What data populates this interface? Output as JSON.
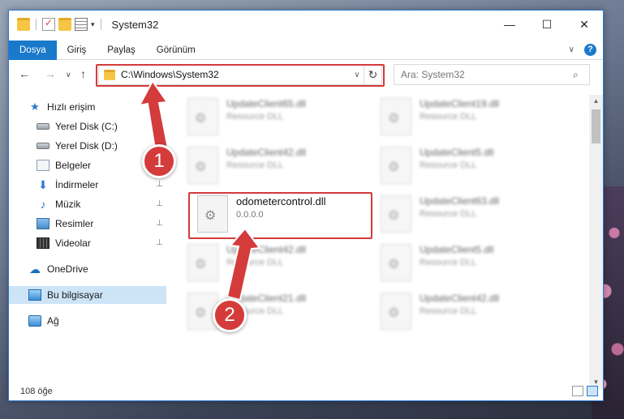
{
  "window": {
    "title": "System32",
    "controls": {
      "minimize": "—",
      "maximize": "☐",
      "close": "✕"
    }
  },
  "ribbon": {
    "tabs": [
      "Dosya",
      "Giriş",
      "Paylaş",
      "Görünüm"
    ],
    "help": "?",
    "expand": "∨"
  },
  "address": {
    "path": "C:\\Windows\\System32",
    "dropdown": "∨",
    "refresh": "↻"
  },
  "nav_buttons": {
    "back": "←",
    "forward": "→",
    "recent": "∨",
    "up": "↑"
  },
  "search": {
    "placeholder": "Ara: System32",
    "icon": "⌕"
  },
  "nav_pane": {
    "items": [
      {
        "label": "Hızlı erişim",
        "icon": "star-icon"
      },
      {
        "label": "Yerel Disk (C:)",
        "icon": "disk-icon",
        "pinned": true
      },
      {
        "label": "Yerel Disk (D:)",
        "icon": "disk-icon",
        "pinned": true
      },
      {
        "label": "Belgeler",
        "icon": "documents-icon",
        "pinned": true
      },
      {
        "label": "İndirmeler",
        "icon": "download-icon",
        "pinned": true
      },
      {
        "label": "Müzik",
        "icon": "music-icon",
        "pinned": true
      },
      {
        "label": "Resimler",
        "icon": "pictures-icon",
        "pinned": true
      },
      {
        "label": "Videolar",
        "icon": "video-icon",
        "pinned": true
      },
      {
        "label": "OneDrive",
        "icon": "cloud-icon"
      },
      {
        "label": "Bu bilgisayar",
        "icon": "computer-icon",
        "selected": true
      },
      {
        "label": "Ağ",
        "icon": "network-icon"
      }
    ],
    "pin_glyph": "📌"
  },
  "files": [
    {
      "name": "UpdateClient65.dll",
      "desc": "Resource DLL",
      "blurred": true
    },
    {
      "name": "UpdateClient19.dll",
      "desc": "Resource DLL",
      "blurred": true
    },
    {
      "name": "UpdateClient42.dll",
      "desc": "Resource DLL",
      "blurred": true
    },
    {
      "name": "UpdateClient5.dll",
      "desc": "Resource DLL",
      "blurred": true
    },
    {
      "name": "odometercontrol.dll",
      "desc": "0.0.0.0",
      "blurred": false
    },
    {
      "name": "UpdateClient63.dll",
      "desc": "Resource DLL",
      "blurred": true
    },
    {
      "name": "UpdateClient42.dll",
      "desc": "Resource DLL",
      "blurred": true
    },
    {
      "name": "UpdateClient5.dll",
      "desc": "Resource DLL",
      "blurred": true
    },
    {
      "name": "UpdateClient21.dll",
      "desc": "Resource DLL",
      "blurred": true
    },
    {
      "name": "UpdateClient42.dll",
      "desc": "Resource DLL",
      "blurred": true
    }
  ],
  "status": {
    "count": "108 öğe"
  },
  "annotations": {
    "step1": "1",
    "step2": "2",
    "color": "#d43b3b"
  }
}
